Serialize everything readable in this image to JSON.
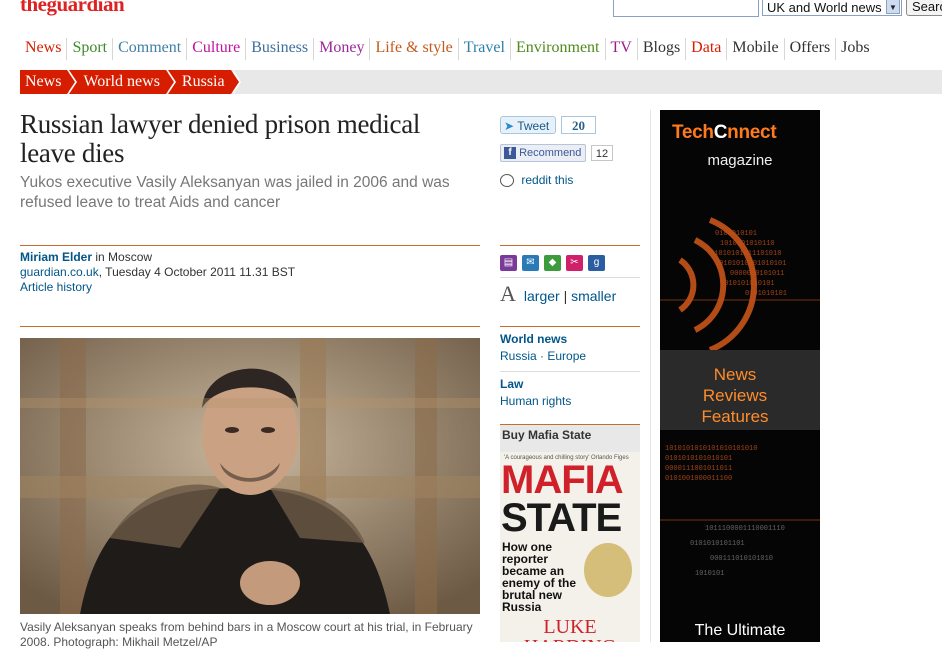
{
  "header": {
    "logo": "theguardian",
    "edition_select": "UK and World news",
    "search_button": "Search"
  },
  "nav": [
    "News",
    "Sport",
    "Comment",
    "Culture",
    "Business",
    "Money",
    "Life & style",
    "Travel",
    "Environment",
    "TV",
    "Blogs",
    "Data",
    "Mobile",
    "Offers",
    "Jobs"
  ],
  "nav_colors": [
    "#d61d00",
    "#3d8a2c",
    "#3f7fa5",
    "#c1129e",
    "#3f6f9b",
    "#9b2a9b",
    "#c15a1d",
    "#2c7fa8",
    "#4f8a1d",
    "#9b1d8a",
    "#333333",
    "#d61d00",
    "#333333",
    "#333333",
    "#333333"
  ],
  "breadcrumb": [
    "News",
    "World news",
    "Russia"
  ],
  "article": {
    "headline": "Russian lawyer denied prison medical leave dies",
    "standfirst": "Yukos executive Vasily Aleksanyan was jailed in 2006 and was refused leave to treat Aids and cancer",
    "author": "Miriam Elder",
    "location": " in Moscow",
    "source": "guardian.co.uk",
    "date": ", Tuesday 4 October 2011 11.31 BST",
    "history": "Article history",
    "caption": "Vasily Aleksanyan speaks from behind bars in a Moscow court at his trial, in February 2008. Photograph: Mikhail Metzel/AP"
  },
  "social": {
    "tweet_label": "Tweet",
    "tweet_count": "20",
    "recommend_label": "Recommend",
    "recommend_count": "12",
    "reddit_label": "reddit this"
  },
  "text_size": {
    "letter": "A",
    "larger": "larger",
    "separator": "|",
    "smaller": "smaller"
  },
  "topics": [
    {
      "heading": "World news",
      "links": "Russia · Europe"
    },
    {
      "heading": "Law",
      "links": "Human rights"
    }
  ],
  "book": {
    "heading": "Buy Mafia State",
    "quote": "'A courageous and chilling story' Orlando Figes",
    "title_line1": "MAFIA",
    "title_line2": "STATE",
    "blurb": "How one reporter became an enemy of the brutal new Russia",
    "author": "LUKE HARDING"
  },
  "ad": {
    "brand_a": "Tech",
    "brand_b": "C",
    "brand_c": "nnect",
    "magazine": "magazine",
    "news": "News",
    "reviews": "Reviews",
    "features": "Features",
    "bottom": "The Ultimate"
  }
}
